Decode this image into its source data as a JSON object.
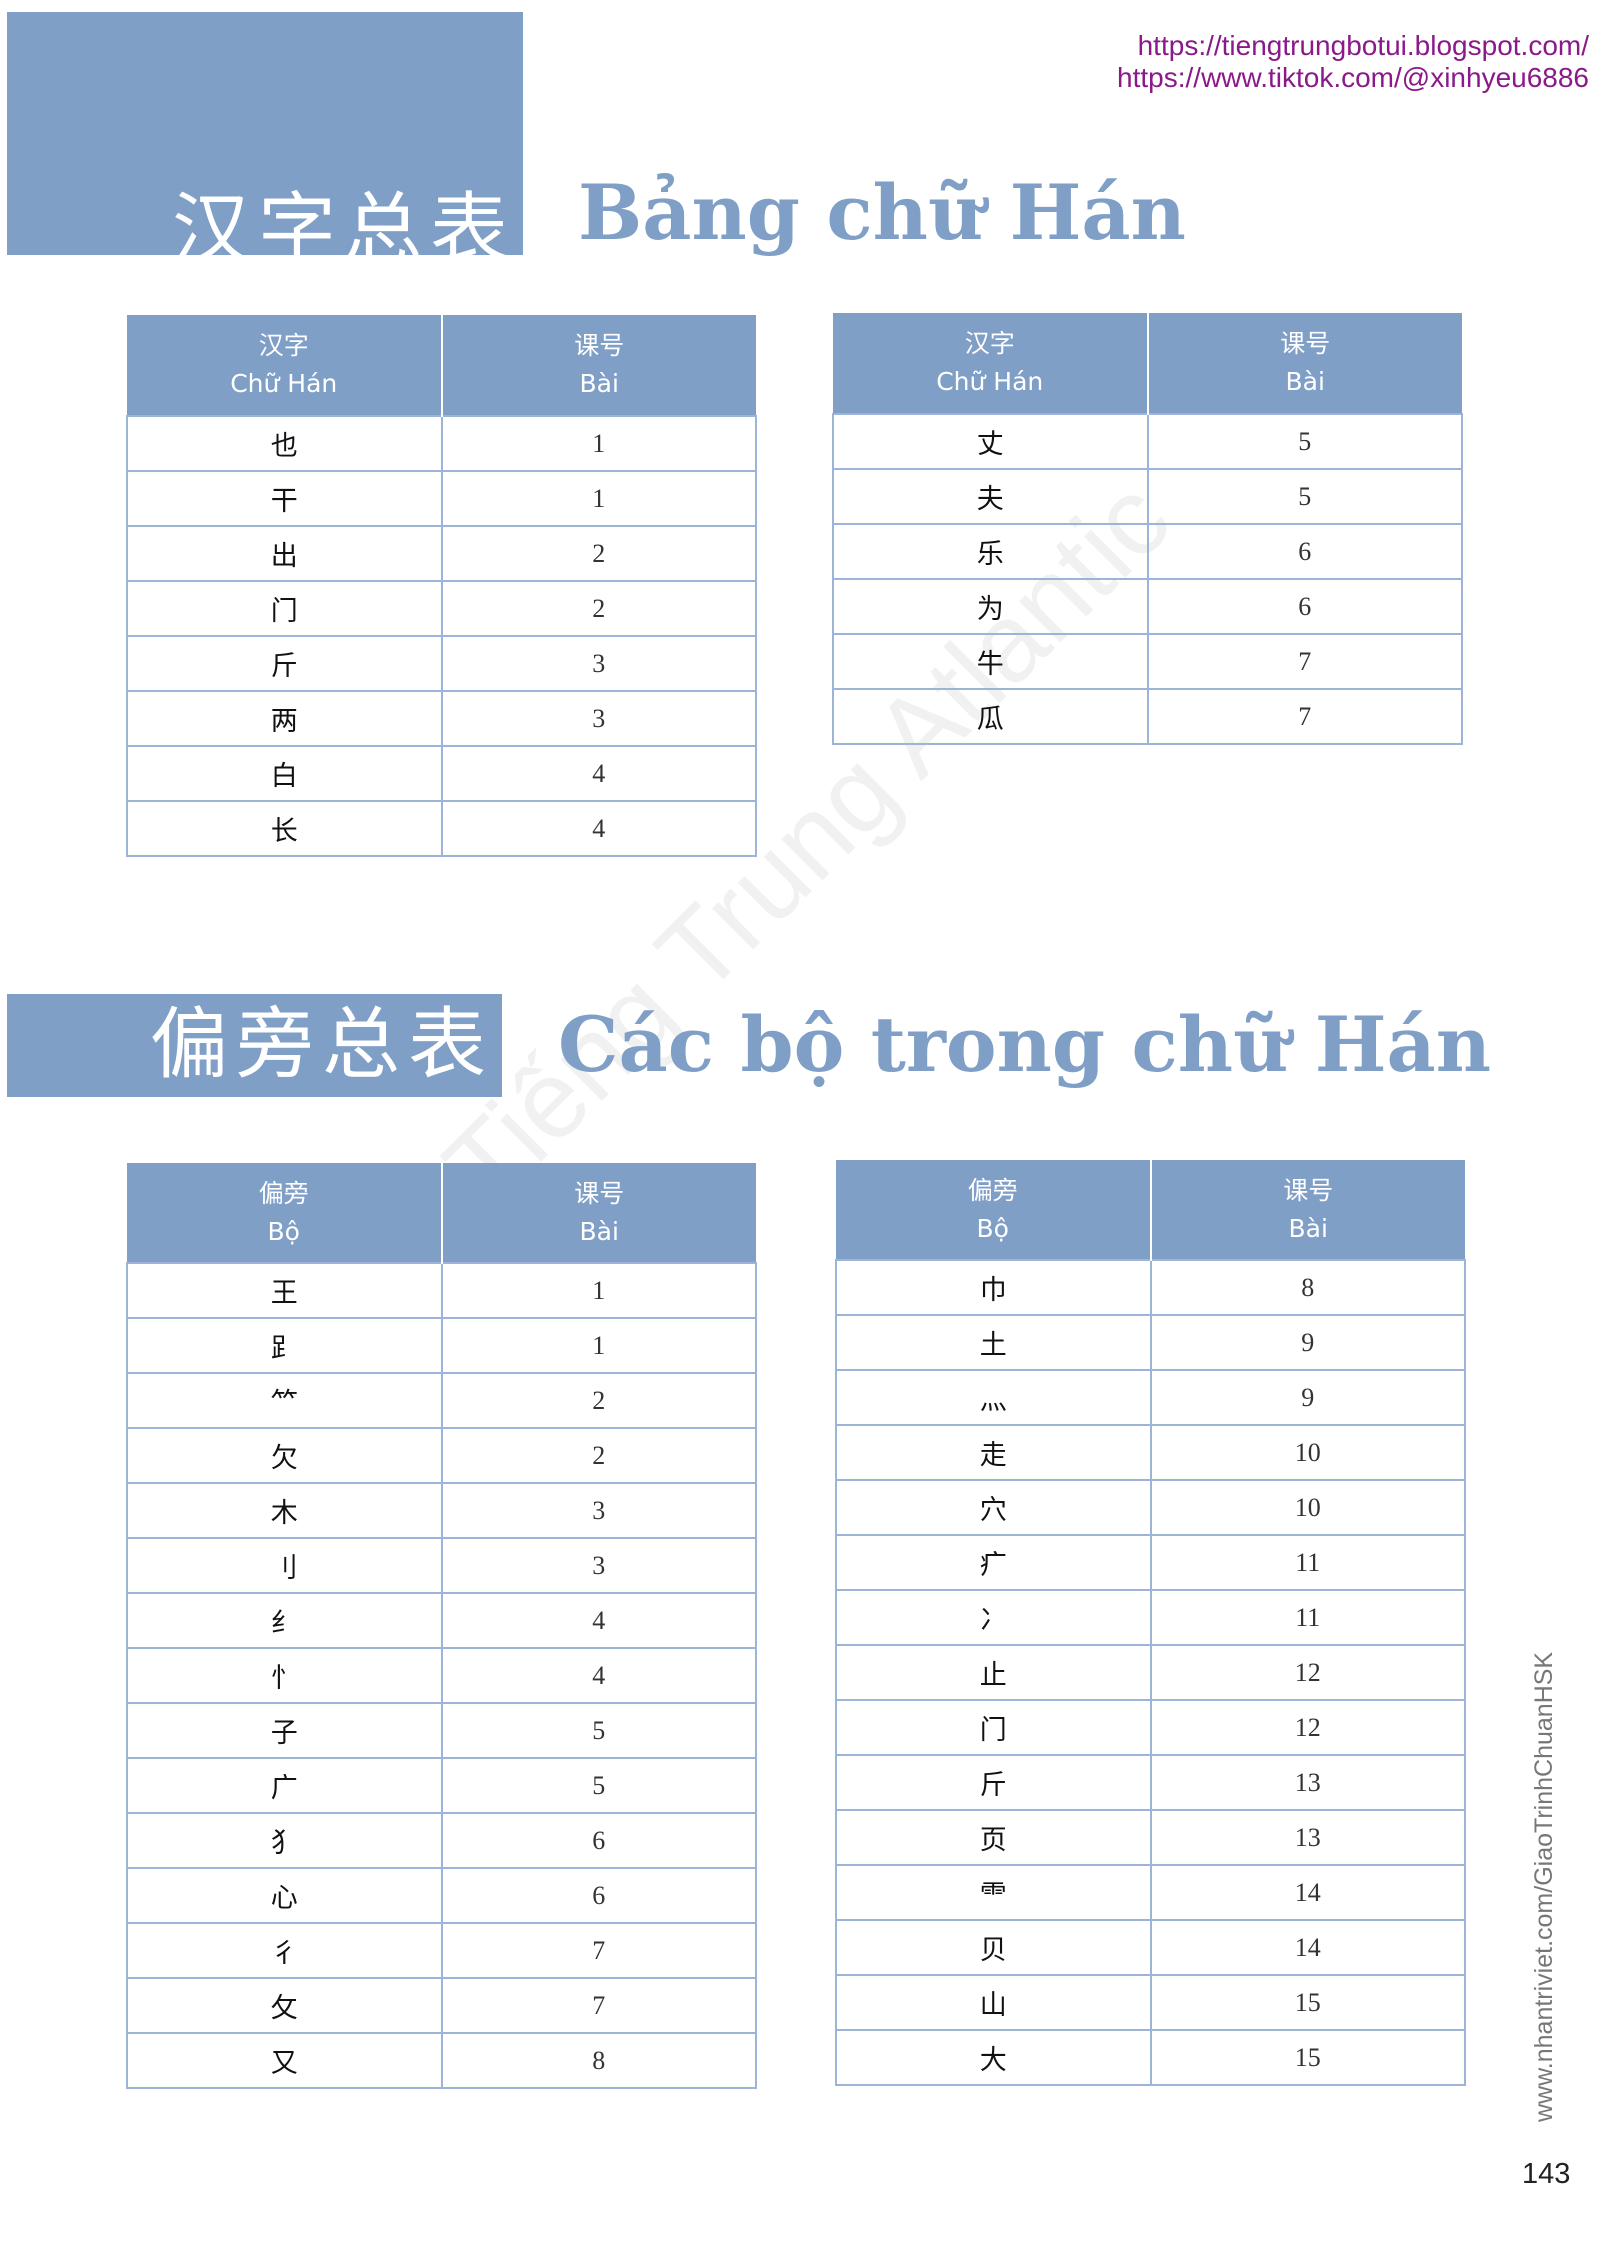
{
  "links": {
    "blog": "https://tiengtrungbotui.blogspot.com/",
    "tiktok": "https://www.tiktok.com/@xinhyeu6886"
  },
  "section1": {
    "title_zh": "汉字总表",
    "title_vi": "Bảng chữ Hán",
    "headers": {
      "char_zh": "汉字",
      "char_vi": "Chữ Hán",
      "lesson_zh": "课号",
      "lesson_vi": "Bài"
    },
    "table_left": [
      {
        "char": "也",
        "lesson": "1"
      },
      {
        "char": "干",
        "lesson": "1"
      },
      {
        "char": "出",
        "lesson": "2"
      },
      {
        "char": "门",
        "lesson": "2"
      },
      {
        "char": "斤",
        "lesson": "3"
      },
      {
        "char": "两",
        "lesson": "3"
      },
      {
        "char": "白",
        "lesson": "4"
      },
      {
        "char": "长",
        "lesson": "4"
      }
    ],
    "table_right": [
      {
        "char": "丈",
        "lesson": "5"
      },
      {
        "char": "夫",
        "lesson": "5"
      },
      {
        "char": "乐",
        "lesson": "6"
      },
      {
        "char": "为",
        "lesson": "6"
      },
      {
        "char": "牛",
        "lesson": "7"
      },
      {
        "char": "瓜",
        "lesson": "7"
      }
    ]
  },
  "section2": {
    "title_zh": "偏旁总表",
    "title_vi": "Các bộ trong chữ Hán",
    "headers": {
      "char_zh": "偏旁",
      "char_vi": "Bộ",
      "lesson_zh": "课号",
      "lesson_vi": "Bài"
    },
    "table_left": [
      {
        "char": "王",
        "lesson": "1"
      },
      {
        "char": "⻊",
        "lesson": "1"
      },
      {
        "char": "⺮",
        "lesson": "2"
      },
      {
        "char": "欠",
        "lesson": "2"
      },
      {
        "char": "木",
        "lesson": "3"
      },
      {
        "char": "刂",
        "lesson": "3"
      },
      {
        "char": "纟",
        "lesson": "4"
      },
      {
        "char": "忄",
        "lesson": "4"
      },
      {
        "char": "子",
        "lesson": "5"
      },
      {
        "char": "广",
        "lesson": "5"
      },
      {
        "char": "犭",
        "lesson": "6"
      },
      {
        "char": "心",
        "lesson": "6"
      },
      {
        "char": "彳",
        "lesson": "7"
      },
      {
        "char": "攵",
        "lesson": "7"
      },
      {
        "char": "又",
        "lesson": "8"
      }
    ],
    "table_right": [
      {
        "char": "巾",
        "lesson": "8"
      },
      {
        "char": "土",
        "lesson": "9"
      },
      {
        "char": "灬",
        "lesson": "9"
      },
      {
        "char": "走",
        "lesson": "10"
      },
      {
        "char": "穴",
        "lesson": "10"
      },
      {
        "char": "疒",
        "lesson": "11"
      },
      {
        "char": "冫",
        "lesson": "11"
      },
      {
        "char": "止",
        "lesson": "12"
      },
      {
        "char": "门",
        "lesson": "12"
      },
      {
        "char": "斤",
        "lesson": "13"
      },
      {
        "char": "页",
        "lesson": "13"
      },
      {
        "char": "⻗",
        "lesson": "14"
      },
      {
        "char": "贝",
        "lesson": "14"
      },
      {
        "char": "山",
        "lesson": "15"
      },
      {
        "char": "大",
        "lesson": "15"
      }
    ]
  },
  "footer": {
    "side_text": "www.nhantriviet.com/GiaoTrinhChuanHSK",
    "page_number": "143"
  },
  "watermark": "Tiếng Trung Atlantic"
}
